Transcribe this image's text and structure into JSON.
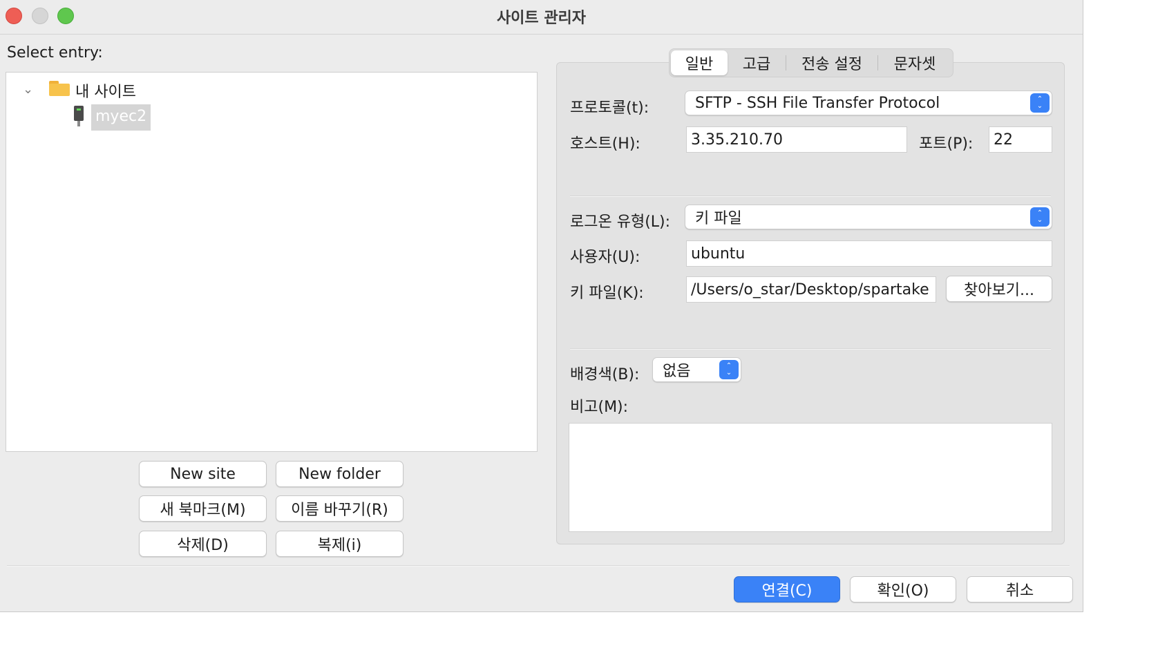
{
  "window": {
    "title": "사이트 관리자"
  },
  "tree": {
    "select_entry_label": "Select entry:",
    "root_folder": "내 사이트",
    "selected_site": "myec2"
  },
  "left_buttons": {
    "new_site": "New site",
    "new_folder": "New folder",
    "new_bookmark": "새 북마크(M)",
    "rename": "이름 바꾸기(R)",
    "delete": "삭제(D)",
    "duplicate": "복제(i)"
  },
  "tabs": {
    "general": "일반",
    "advanced": "고급",
    "transfer": "전송 설정",
    "charset": "문자셋",
    "active": "일반"
  },
  "general": {
    "protocol_label": "프로토콜(t):",
    "protocol_value": "SFTP - SSH File Transfer Protocol",
    "host_label": "호스트(H):",
    "host_value": "3.35.210.70",
    "port_label": "포트(P):",
    "port_value": "22",
    "logon_type_label": "로그온 유형(L):",
    "logon_type_value": "키 파일",
    "user_label": "사용자(U):",
    "user_value": "ubuntu",
    "keyfile_label": "키 파일(K):",
    "keyfile_value": "/Users/o_star/Desktop/spartake",
    "browse_button": "찾아보기...",
    "background_label": "배경색(B):",
    "background_value": "없음",
    "comments_label": "비고(M):"
  },
  "footer": {
    "connect": "연결(C)",
    "ok": "확인(O)",
    "cancel": "취소"
  },
  "colors": {
    "accent": "#3a82f7",
    "window_bg": "#ececec"
  }
}
